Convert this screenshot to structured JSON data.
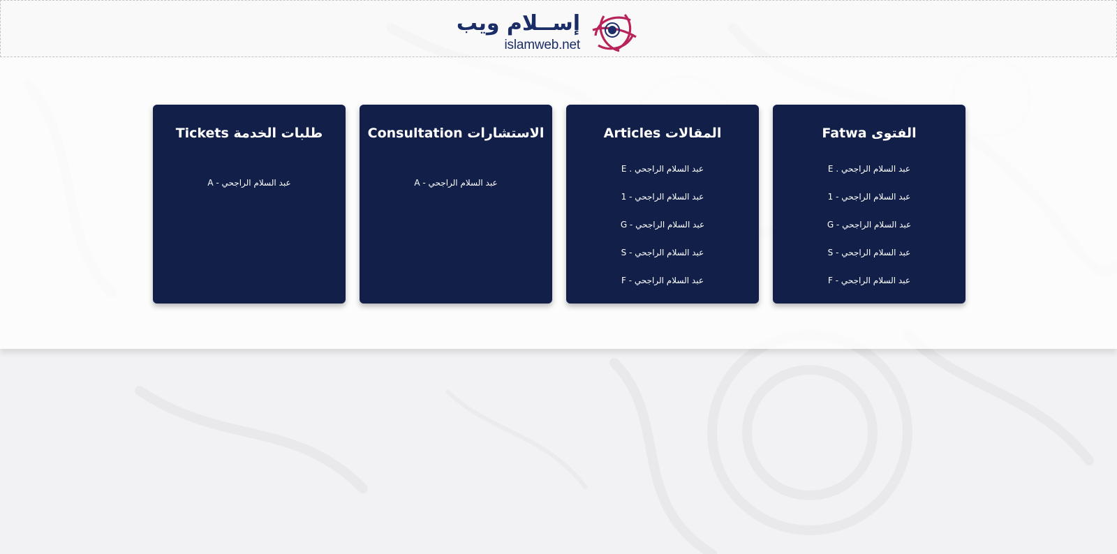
{
  "header": {
    "logo": {
      "arabic": "إســلام ويب",
      "latin": "islamweb.net"
    }
  },
  "colors": {
    "card_background": "#122049",
    "logo_text": "#1b2d66",
    "logo_mark": "#b8245a",
    "page_background": "#f2f2f4"
  },
  "cards": [
    {
      "title": "الفتوى Fatwa",
      "items": [
        "E . عبد السلام الراجحي",
        "عبد السلام الراجحي - 1",
        "G - عبد السلام الراجحي",
        "S - عبد السلام الراجحي",
        "F - عبد السلام الراجحي"
      ]
    },
    {
      "title": "المقالات Articles",
      "items": [
        "E . عبد السلام الراجحي",
        "عبد السلام الراجحي - 1",
        "G - عبد السلام الراجحي",
        "S - عبد السلام الراجحي",
        "F - عبد السلام الراجحي"
      ]
    },
    {
      "title": "الاستشارات Consultation",
      "items": [
        "A - عبد السلام الراجحي"
      ]
    },
    {
      "title": "طلبات الخدمة Tickets",
      "items": [
        "A - عبد السلام الراجحي"
      ]
    }
  ]
}
